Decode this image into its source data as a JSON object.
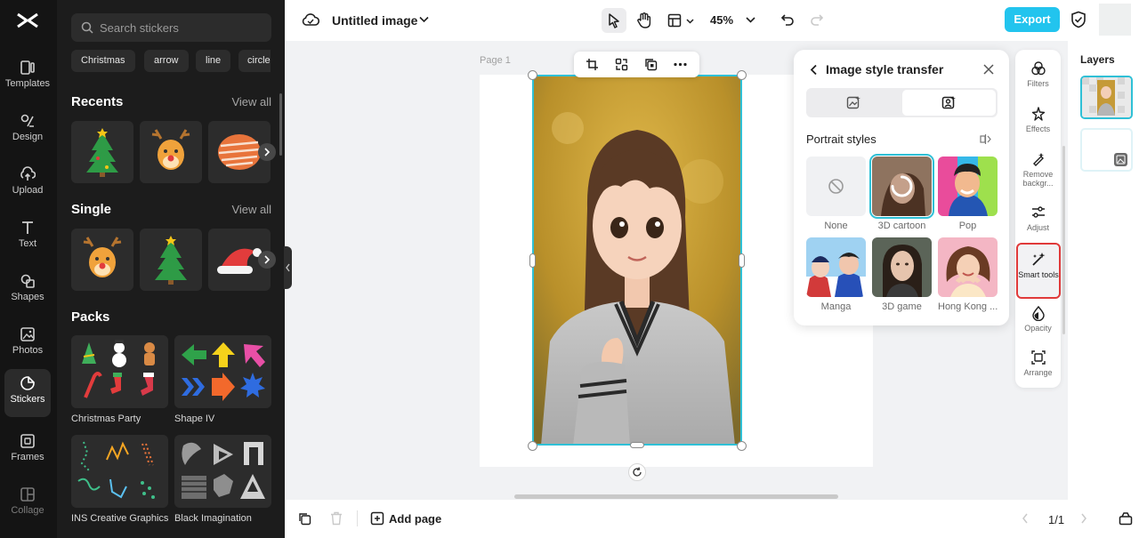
{
  "nav": {
    "items": [
      {
        "label": "Templates",
        "icon": "templates-icon"
      },
      {
        "label": "Design",
        "icon": "design-icon"
      },
      {
        "label": "Upload",
        "icon": "upload-icon"
      },
      {
        "label": "Text",
        "icon": "text-icon"
      },
      {
        "label": "Shapes",
        "icon": "shapes-icon"
      },
      {
        "label": "Photos",
        "icon": "photos-icon"
      },
      {
        "label": "Stickers",
        "icon": "stickers-icon"
      },
      {
        "label": "Frames",
        "icon": "frames-icon"
      },
      {
        "label": "Collage",
        "icon": "collage-icon"
      }
    ],
    "active": "Stickers"
  },
  "stickers": {
    "search_placeholder": "Search stickers",
    "chips": [
      "Christmas",
      "arrow",
      "line",
      "circle"
    ],
    "recents_title": "Recents",
    "single_title": "Single",
    "packs_title": "Packs",
    "view_all": "View all",
    "packs": [
      {
        "label": "Christmas Party"
      },
      {
        "label": "Shape IV"
      },
      {
        "label": "INS Creative Graphics"
      },
      {
        "label": "Black Imagination"
      }
    ]
  },
  "topbar": {
    "title": "Untitled image",
    "zoom": "45%",
    "export_label": "Export"
  },
  "canvas": {
    "page_label": "Page 1"
  },
  "bottombar": {
    "add_page_label": "Add page",
    "pager": "1/1"
  },
  "style_transfer": {
    "title": "Image style transfer",
    "section_title": "Portrait styles",
    "selected": "3D cartoon",
    "styles": [
      {
        "label": "None"
      },
      {
        "label": "3D cartoon"
      },
      {
        "label": "Pop"
      },
      {
        "label": "Manga"
      },
      {
        "label": "3D game"
      },
      {
        "label": "Hong Kong ..."
      }
    ]
  },
  "tools": {
    "items": [
      {
        "label": "Filters"
      },
      {
        "label": "Effects"
      },
      {
        "label": "Remove backgr..."
      },
      {
        "label": "Adjust"
      },
      {
        "label": "Smart tools"
      },
      {
        "label": "Opacity"
      },
      {
        "label": "Arrange"
      }
    ],
    "highlighted": "Smart tools"
  },
  "layers": {
    "title": "Layers"
  },
  "colors": {
    "accent": "#22c4ee",
    "selection": "#2fc0d6",
    "highlight_outline": "#e03a3a",
    "dark_panel": "#1c1c1c"
  }
}
